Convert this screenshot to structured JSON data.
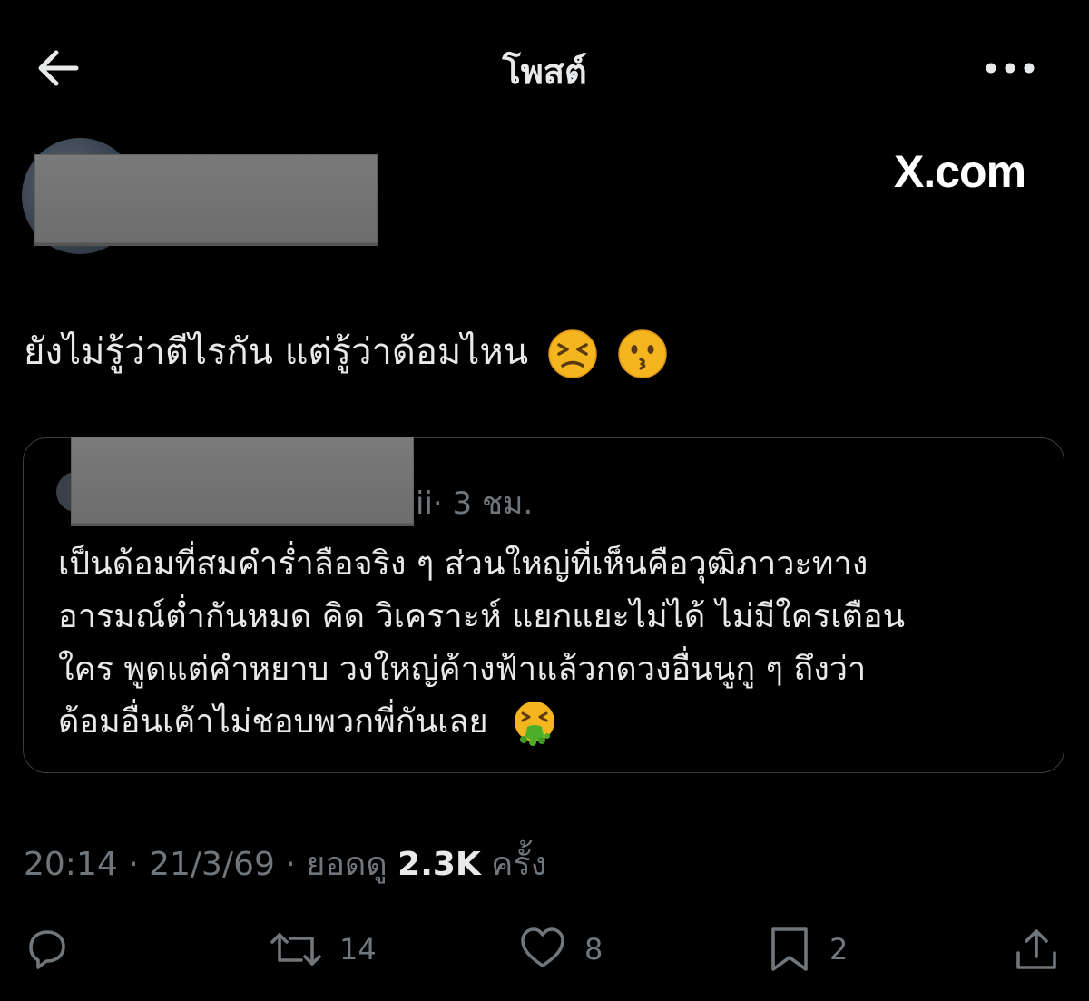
{
  "header": {
    "title": "โพสต์"
  },
  "author": {
    "source_label": "X.com"
  },
  "tweet": {
    "text": "ยังไม่รู้ว่าตีไรกัน แต่รู้ว่าด้อมไหน",
    "emojis": [
      "persevering-face",
      "kissing-face"
    ]
  },
  "quote": {
    "handle_tail": "ii",
    "time": "· 3 ชม.",
    "lines": [
      "เป็นด้อมที่สมคำร่ำลือจริง ๆ ส่วนใหญ่ที่เห็นคือวุฒิภาวะทาง",
      "อารมณ์ต่ำกันหมด คิด วิเคราะห์ แยกแยะไม่ได้ ไม่มีใครเตือน",
      "ใคร พูดแต่คำหยาบ วงใหญ่ค้างฟ้าแล้วกดวงอื่นนูกู ๆ ถึงว่า",
      "ด้อมอื่นเค้าไม่ชอบพวกพี่กันเลย"
    ],
    "emoji": "vomiting-face"
  },
  "meta": {
    "time": "20:14",
    "sep1": " · ",
    "date": "21/3/69",
    "sep2": " · ",
    "views_label": "ยอดดู",
    "views": "2.3K",
    "views_unit": "ครั้ง"
  },
  "actions": {
    "reply": "",
    "retweets": "14",
    "likes": "8",
    "bookmarks": "2"
  },
  "colors": {
    "background": "#000000",
    "text": "#e7e9ea",
    "muted": "#71767b",
    "border": "#3a3e43"
  }
}
